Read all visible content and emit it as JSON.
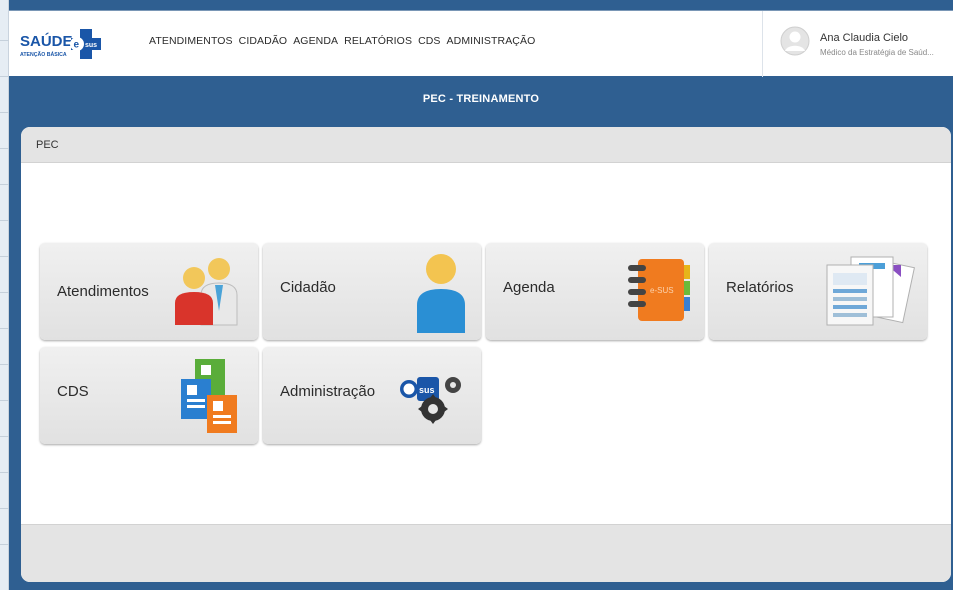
{
  "header": {
    "logo": {
      "main_text": "SAÚDE",
      "badge_text": "sus",
      "sub_text": "ATENÇÃO BÁSICA"
    },
    "nav": [
      "ATENDIMENTOS",
      "CIDADÃO",
      "AGENDA",
      "RELATÓRIOS",
      "CDS",
      "ADMINISTRAÇÃO"
    ],
    "user": {
      "name": "Ana Claudia Cielo",
      "role": "Médico da Estratégia de Saúd..."
    }
  },
  "environment_title": "PEC - TREINAMENTO",
  "panel": {
    "title": "PEC"
  },
  "tiles": [
    {
      "label": "Atendimentos",
      "icon": "people-icon"
    },
    {
      "label": "Cidadão",
      "icon": "citizen-icon"
    },
    {
      "label": "Agenda",
      "icon": "agenda-notebook-icon"
    },
    {
      "label": "Relatórios",
      "icon": "reports-documents-icon"
    },
    {
      "label": "CDS",
      "icon": "cds-forms-icon"
    },
    {
      "label": "Administração",
      "icon": "esus-gears-icon"
    }
  ],
  "tile_icon_texts": {
    "agenda_cover": "e-SUS",
    "admin_badge": "sus"
  },
  "colors": {
    "brand_blue": "#2f5f91",
    "logo_blue": "#1a56a8",
    "tile_bg": "#e6e6e6",
    "panel_header": "#e4e4e4"
  }
}
